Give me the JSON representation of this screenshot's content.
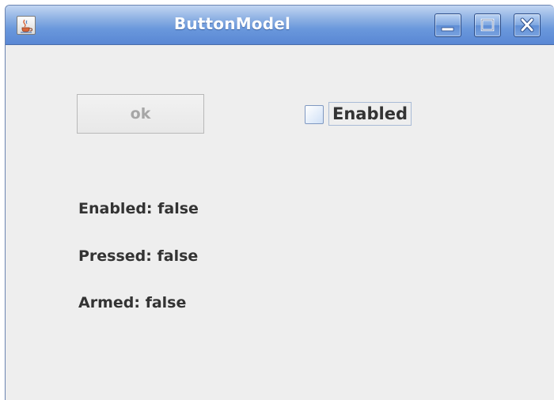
{
  "window": {
    "title": "ButtonModel",
    "icon": "java-cup-icon",
    "controls": [
      "minimize-icon",
      "maximize-icon",
      "close-icon"
    ]
  },
  "main": {
    "ok_button_label": "ok",
    "ok_button_enabled": false,
    "checkbox_label": "Enabled",
    "checkbox_checked": false,
    "status": {
      "enabled": "Enabled: false",
      "pressed": "Pressed: false",
      "armed": "Armed: false"
    }
  },
  "colors": {
    "titlebar": "#6a98dc",
    "panel_background": "#eeeeee",
    "text": "#333333",
    "disabled_text": "#a6a6a6"
  }
}
